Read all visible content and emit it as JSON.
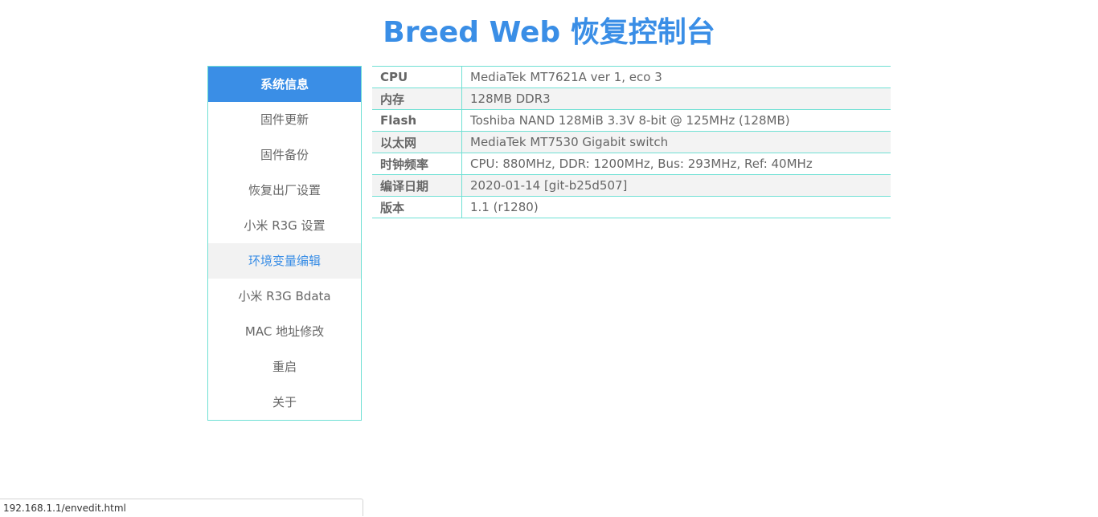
{
  "header": {
    "title": "Breed Web 恢复控制台"
  },
  "sidebar": {
    "items": [
      {
        "label": "系统信息",
        "state": "active"
      },
      {
        "label": "固件更新",
        "state": "normal"
      },
      {
        "label": "固件备份",
        "state": "normal"
      },
      {
        "label": "恢复出厂设置",
        "state": "normal"
      },
      {
        "label": "小米 R3G 设置",
        "state": "normal"
      },
      {
        "label": "环境变量编辑",
        "state": "hover"
      },
      {
        "label": "小米 R3G Bdata",
        "state": "normal"
      },
      {
        "label": "MAC 地址修改",
        "state": "normal"
      },
      {
        "label": "重启",
        "state": "normal"
      },
      {
        "label": "关于",
        "state": "normal"
      }
    ]
  },
  "system_info": {
    "rows": [
      {
        "key": "CPU",
        "value": "MediaTek MT7621A ver 1, eco 3"
      },
      {
        "key": "内存",
        "value": "128MB DDR3"
      },
      {
        "key": "Flash",
        "value": "Toshiba NAND 128MiB 3.3V 8-bit @ 125MHz (128MB)"
      },
      {
        "key": "以太网",
        "value": "MediaTek MT7530 Gigabit switch"
      },
      {
        "key": "时钟频率",
        "value": "CPU: 880MHz, DDR: 1200MHz, Bus: 293MHz, Ref: 40MHz"
      },
      {
        "key": "编译日期",
        "value": "2020-01-14 [git-b25d507]"
      },
      {
        "key": "版本",
        "value": "1.1 (r1280)"
      }
    ]
  },
  "status_bar": {
    "url": "192.168.1.1/envedit.html"
  },
  "colors": {
    "accent": "#3a8ee6",
    "border": "#6fe0d4",
    "text": "#666666",
    "row_alt": "#f3f3f3"
  }
}
